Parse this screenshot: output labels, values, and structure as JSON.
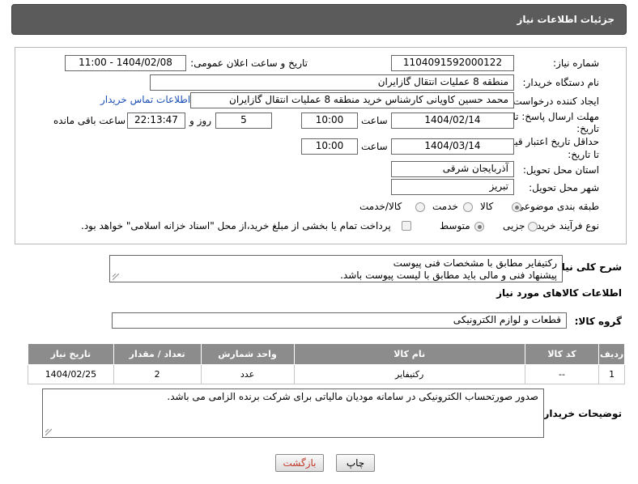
{
  "header": {
    "title": "جزئیات اطلاعات نیاز"
  },
  "form": {
    "need_number": {
      "label": "شماره نیاز:",
      "value": "1104091592000122"
    },
    "announce_datetime": {
      "label": "تاریخ و ساعت اعلان عمومی:",
      "value": "1404/02/08 - 11:00"
    },
    "buyer_org": {
      "label": "نام دستگاه خریدار:",
      "value": "منطقه 8 عملیات انتقال گازایران"
    },
    "requester": {
      "label": "ایجاد کننده درخواست:",
      "value": "محمد حسین کاویانی کارشناس خرید منطقه 8 عملیات انتقال گازایران",
      "contact_link": "اطلاعات تماس خریدار"
    },
    "response_deadline": {
      "label_line1": "مهلت ارسال پاسخ: تا",
      "label_line2": "تاریخ:",
      "date": "1404/02/14",
      "time_label": "ساعت",
      "time": "10:00",
      "days": "5",
      "days_label": "روز و",
      "remaining": "22:13:47",
      "remaining_label": "ساعت باقی مانده"
    },
    "price_validity": {
      "label_line1": "حداقل تاریخ اعتبار قیمت:",
      "label_line2": "تا تاریخ:",
      "date": "1404/03/14",
      "time_label": "ساعت",
      "time": "10:00"
    },
    "delivery_province": {
      "label": "استان محل تحویل:",
      "value": "آذربایجان شرقی"
    },
    "delivery_city": {
      "label": "شهر محل تحویل:",
      "value": "تبریز"
    },
    "category": {
      "label": "طبقه بندی موضوعی:",
      "options": [
        "کالا",
        "خدمت",
        "کالا/خدمت"
      ],
      "selected": "کالا"
    },
    "purchase_type": {
      "label": "نوع فرآیند خرید :",
      "options": [
        "جزیی",
        "متوسط"
      ],
      "selected": "متوسط",
      "note": "پرداخت تمام یا بخشی از مبلغ خرید،از محل \"اسناد خزانه اسلامی\" خواهد بود."
    }
  },
  "general_description": {
    "label": "شرح کلی نیاز:",
    "line1": "رکتیفایر مطابق با مشخصات فنی پیوست",
    "line2": "پیشنهاد فنی و مالی باید مطابق با لیست پیوست باشد."
  },
  "goods_info": {
    "title": "اطلاعات کالاهای مورد نیاز",
    "group_label": "گروه کالا:",
    "group_value": "قطعات و لوازم الکترونیکی",
    "columns": [
      "ردیف",
      "کد کالا",
      "نام کالا",
      "واحد شمارش",
      "تعداد / مقدار",
      "تاریخ نیاز"
    ],
    "rows": [
      {
        "row": "1",
        "code": "--",
        "name": "رکتیفایر",
        "unit": "عدد",
        "qty": "2",
        "date": "1404/02/25"
      }
    ]
  },
  "buyer_notes": {
    "label": "توضیحات خریدار:",
    "text": "صدور صورتحساب الکترونیکی در سامانه مودیان مالیاتی برای شرکت برنده الزامی می باشد."
  },
  "buttons": {
    "print": "چاپ",
    "back": "بازگشت"
  },
  "colors": {
    "header_bg": "#5b5b5b",
    "table_header_bg": "#8c8c8c",
    "link": "#1a4fb5",
    "back_button_text": "#c0392b"
  }
}
